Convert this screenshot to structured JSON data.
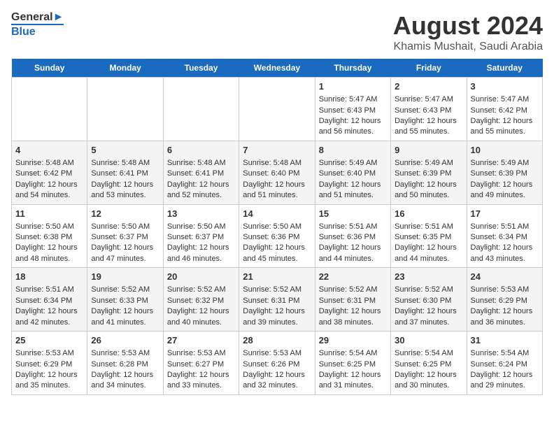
{
  "logo": {
    "line1": "General",
    "line2": "Blue"
  },
  "title": "August 2024",
  "subtitle": "Khamis Mushait, Saudi Arabia",
  "days_of_week": [
    "Sunday",
    "Monday",
    "Tuesday",
    "Wednesday",
    "Thursday",
    "Friday",
    "Saturday"
  ],
  "weeks": [
    [
      {
        "day": "",
        "sunrise": "",
        "sunset": "",
        "daylight": ""
      },
      {
        "day": "",
        "sunrise": "",
        "sunset": "",
        "daylight": ""
      },
      {
        "day": "",
        "sunrise": "",
        "sunset": "",
        "daylight": ""
      },
      {
        "day": "",
        "sunrise": "",
        "sunset": "",
        "daylight": ""
      },
      {
        "day": "1",
        "sunrise": "Sunrise: 5:47 AM",
        "sunset": "Sunset: 6:43 PM",
        "daylight": "Daylight: 12 hours and 56 minutes."
      },
      {
        "day": "2",
        "sunrise": "Sunrise: 5:47 AM",
        "sunset": "Sunset: 6:43 PM",
        "daylight": "Daylight: 12 hours and 55 minutes."
      },
      {
        "day": "3",
        "sunrise": "Sunrise: 5:47 AM",
        "sunset": "Sunset: 6:42 PM",
        "daylight": "Daylight: 12 hours and 55 minutes."
      }
    ],
    [
      {
        "day": "4",
        "sunrise": "Sunrise: 5:48 AM",
        "sunset": "Sunset: 6:42 PM",
        "daylight": "Daylight: 12 hours and 54 minutes."
      },
      {
        "day": "5",
        "sunrise": "Sunrise: 5:48 AM",
        "sunset": "Sunset: 6:41 PM",
        "daylight": "Daylight: 12 hours and 53 minutes."
      },
      {
        "day": "6",
        "sunrise": "Sunrise: 5:48 AM",
        "sunset": "Sunset: 6:41 PM",
        "daylight": "Daylight: 12 hours and 52 minutes."
      },
      {
        "day": "7",
        "sunrise": "Sunrise: 5:48 AM",
        "sunset": "Sunset: 6:40 PM",
        "daylight": "Daylight: 12 hours and 51 minutes."
      },
      {
        "day": "8",
        "sunrise": "Sunrise: 5:49 AM",
        "sunset": "Sunset: 6:40 PM",
        "daylight": "Daylight: 12 hours and 51 minutes."
      },
      {
        "day": "9",
        "sunrise": "Sunrise: 5:49 AM",
        "sunset": "Sunset: 6:39 PM",
        "daylight": "Daylight: 12 hours and 50 minutes."
      },
      {
        "day": "10",
        "sunrise": "Sunrise: 5:49 AM",
        "sunset": "Sunset: 6:39 PM",
        "daylight": "Daylight: 12 hours and 49 minutes."
      }
    ],
    [
      {
        "day": "11",
        "sunrise": "Sunrise: 5:50 AM",
        "sunset": "Sunset: 6:38 PM",
        "daylight": "Daylight: 12 hours and 48 minutes."
      },
      {
        "day": "12",
        "sunrise": "Sunrise: 5:50 AM",
        "sunset": "Sunset: 6:37 PM",
        "daylight": "Daylight: 12 hours and 47 minutes."
      },
      {
        "day": "13",
        "sunrise": "Sunrise: 5:50 AM",
        "sunset": "Sunset: 6:37 PM",
        "daylight": "Daylight: 12 hours and 46 minutes."
      },
      {
        "day": "14",
        "sunrise": "Sunrise: 5:50 AM",
        "sunset": "Sunset: 6:36 PM",
        "daylight": "Daylight: 12 hours and 45 minutes."
      },
      {
        "day": "15",
        "sunrise": "Sunrise: 5:51 AM",
        "sunset": "Sunset: 6:36 PM",
        "daylight": "Daylight: 12 hours and 44 minutes."
      },
      {
        "day": "16",
        "sunrise": "Sunrise: 5:51 AM",
        "sunset": "Sunset: 6:35 PM",
        "daylight": "Daylight: 12 hours and 44 minutes."
      },
      {
        "day": "17",
        "sunrise": "Sunrise: 5:51 AM",
        "sunset": "Sunset: 6:34 PM",
        "daylight": "Daylight: 12 hours and 43 minutes."
      }
    ],
    [
      {
        "day": "18",
        "sunrise": "Sunrise: 5:51 AM",
        "sunset": "Sunset: 6:34 PM",
        "daylight": "Daylight: 12 hours and 42 minutes."
      },
      {
        "day": "19",
        "sunrise": "Sunrise: 5:52 AM",
        "sunset": "Sunset: 6:33 PM",
        "daylight": "Daylight: 12 hours and 41 minutes."
      },
      {
        "day": "20",
        "sunrise": "Sunrise: 5:52 AM",
        "sunset": "Sunset: 6:32 PM",
        "daylight": "Daylight: 12 hours and 40 minutes."
      },
      {
        "day": "21",
        "sunrise": "Sunrise: 5:52 AM",
        "sunset": "Sunset: 6:31 PM",
        "daylight": "Daylight: 12 hours and 39 minutes."
      },
      {
        "day": "22",
        "sunrise": "Sunrise: 5:52 AM",
        "sunset": "Sunset: 6:31 PM",
        "daylight": "Daylight: 12 hours and 38 minutes."
      },
      {
        "day": "23",
        "sunrise": "Sunrise: 5:52 AM",
        "sunset": "Sunset: 6:30 PM",
        "daylight": "Daylight: 12 hours and 37 minutes."
      },
      {
        "day": "24",
        "sunrise": "Sunrise: 5:53 AM",
        "sunset": "Sunset: 6:29 PM",
        "daylight": "Daylight: 12 hours and 36 minutes."
      }
    ],
    [
      {
        "day": "25",
        "sunrise": "Sunrise: 5:53 AM",
        "sunset": "Sunset: 6:29 PM",
        "daylight": "Daylight: 12 hours and 35 minutes."
      },
      {
        "day": "26",
        "sunrise": "Sunrise: 5:53 AM",
        "sunset": "Sunset: 6:28 PM",
        "daylight": "Daylight: 12 hours and 34 minutes."
      },
      {
        "day": "27",
        "sunrise": "Sunrise: 5:53 AM",
        "sunset": "Sunset: 6:27 PM",
        "daylight": "Daylight: 12 hours and 33 minutes."
      },
      {
        "day": "28",
        "sunrise": "Sunrise: 5:53 AM",
        "sunset": "Sunset: 6:26 PM",
        "daylight": "Daylight: 12 hours and 32 minutes."
      },
      {
        "day": "29",
        "sunrise": "Sunrise: 5:54 AM",
        "sunset": "Sunset: 6:25 PM",
        "daylight": "Daylight: 12 hours and 31 minutes."
      },
      {
        "day": "30",
        "sunrise": "Sunrise: 5:54 AM",
        "sunset": "Sunset: 6:25 PM",
        "daylight": "Daylight: 12 hours and 30 minutes."
      },
      {
        "day": "31",
        "sunrise": "Sunrise: 5:54 AM",
        "sunset": "Sunset: 6:24 PM",
        "daylight": "Daylight: 12 hours and 29 minutes."
      }
    ]
  ]
}
